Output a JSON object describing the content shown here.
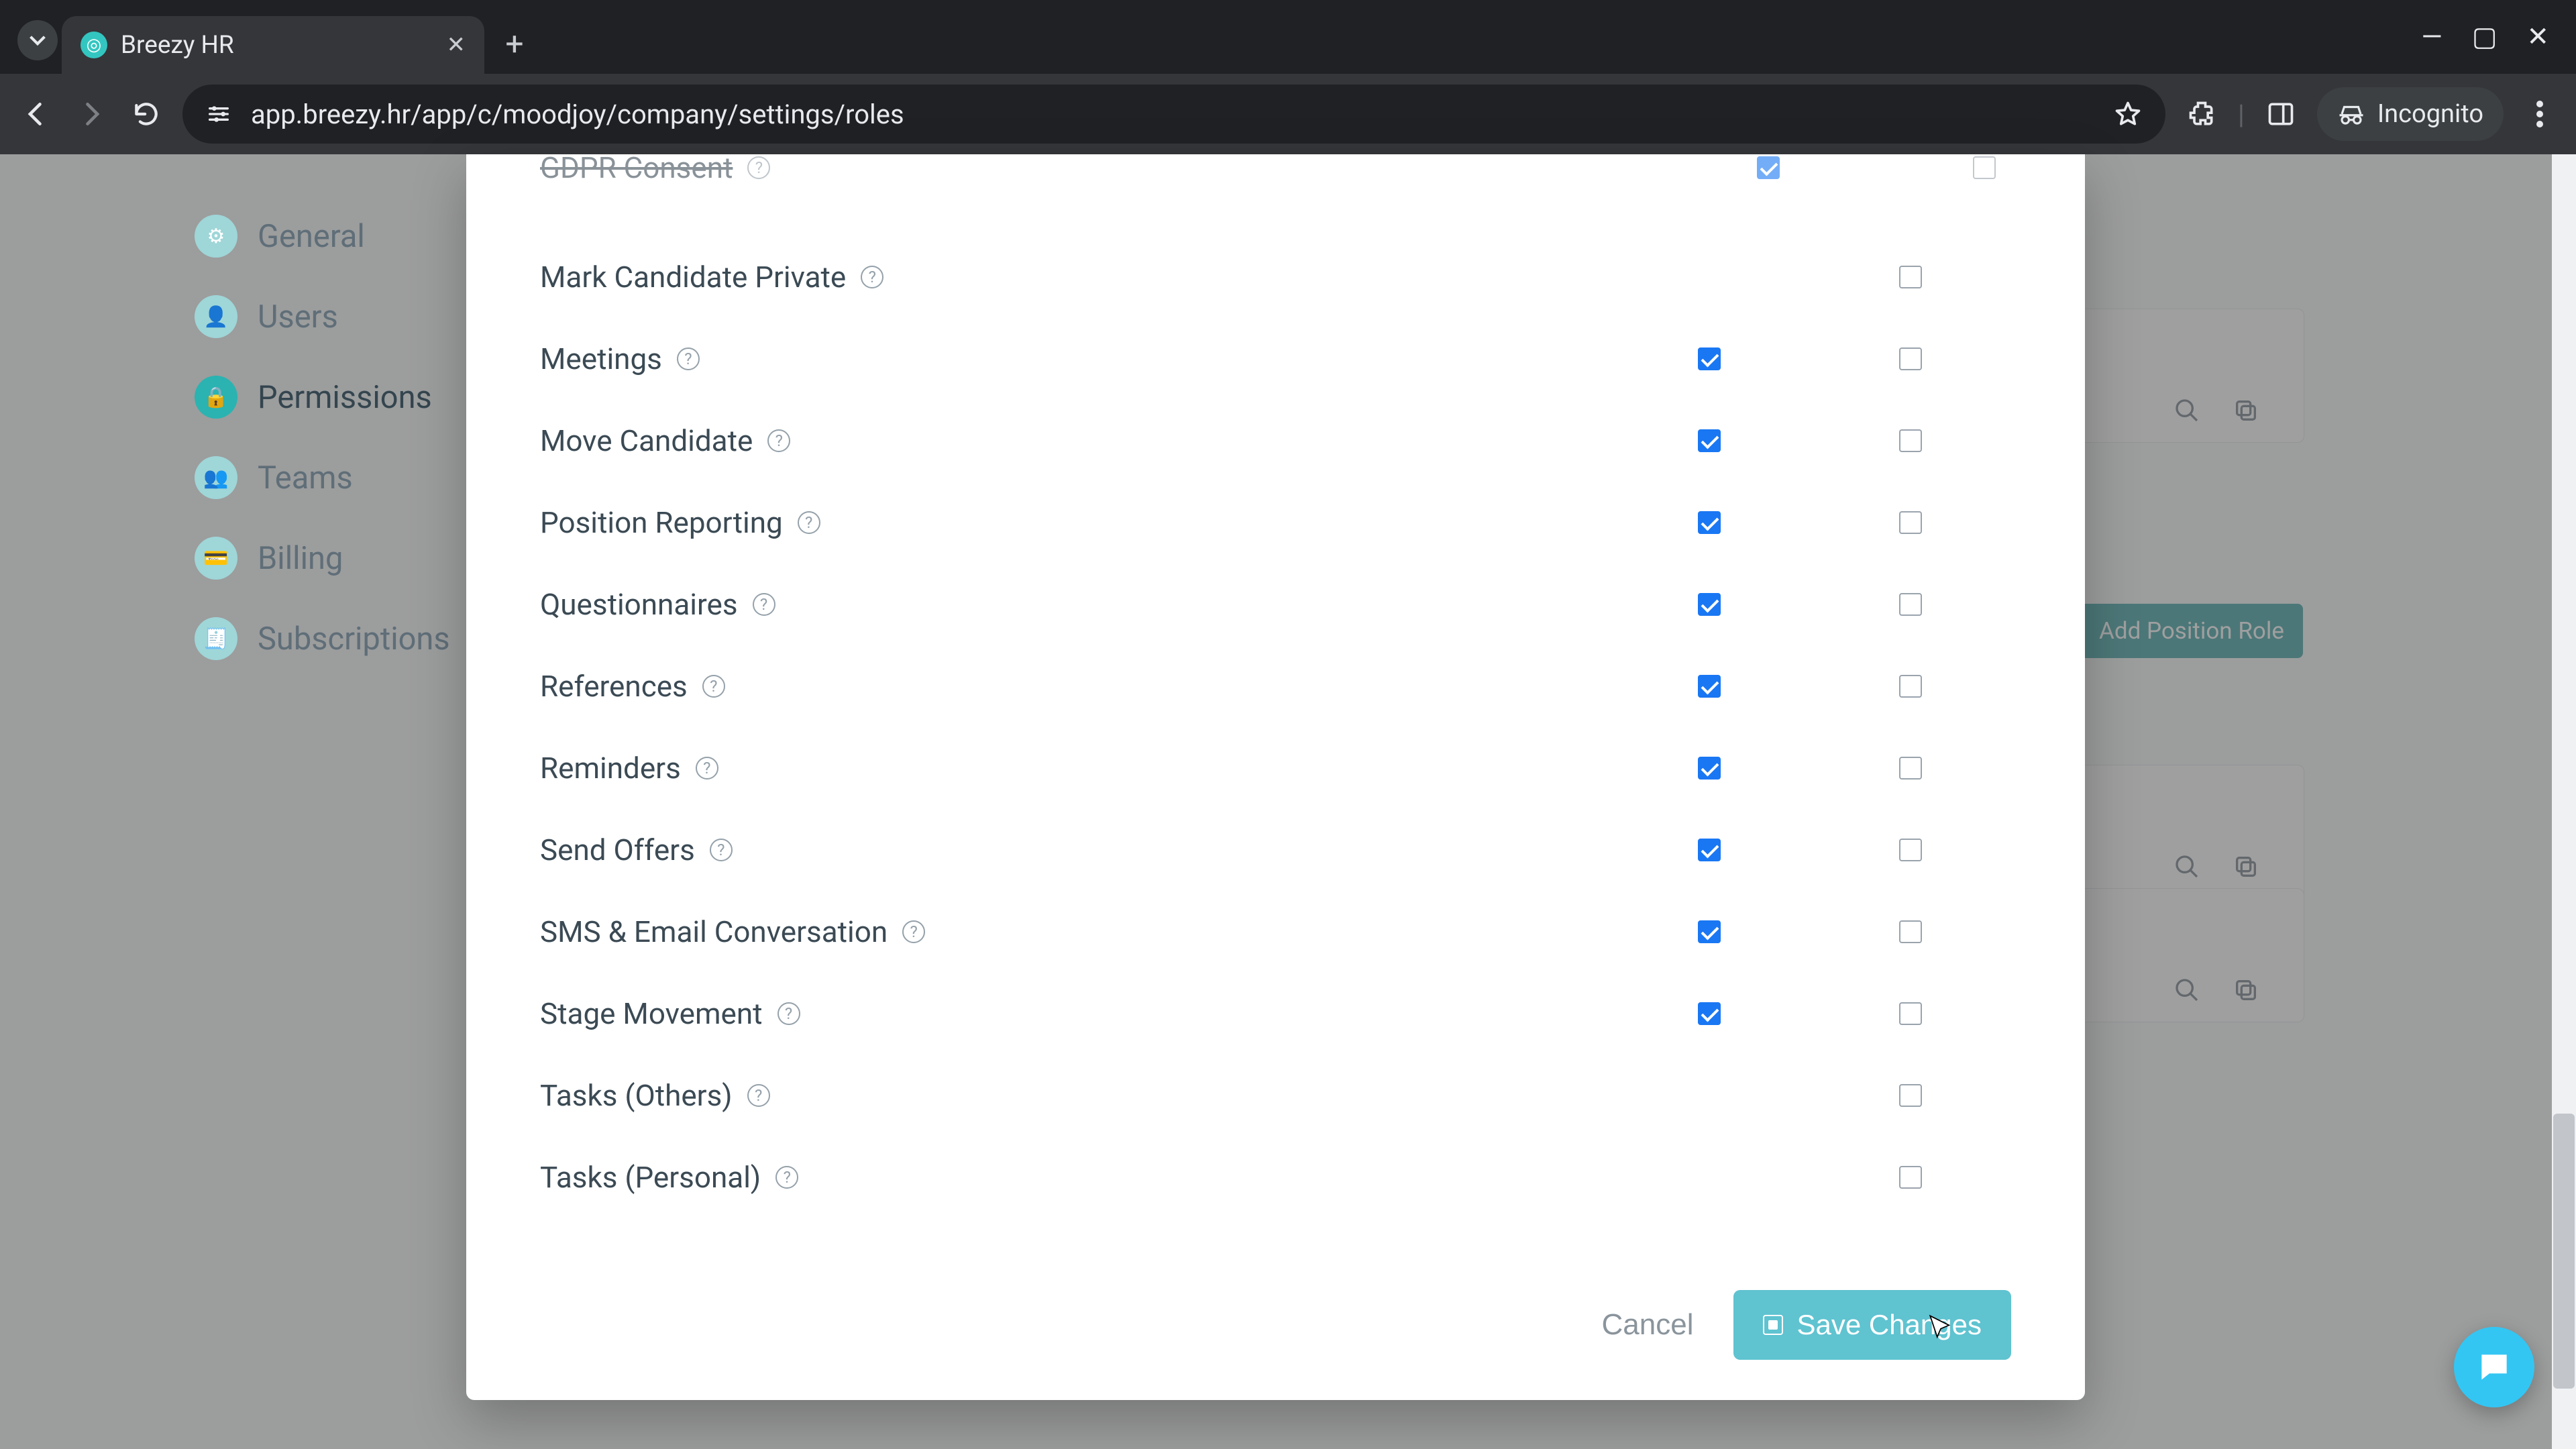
{
  "browser": {
    "tab_title": "Breezy HR",
    "url": "app.breezy.hr/app/c/moodjoy/company/settings/roles",
    "incognito_label": "Incognito"
  },
  "sidebar": {
    "items": [
      {
        "label": "General"
      },
      {
        "label": "Users"
      },
      {
        "label": "Permissions"
      },
      {
        "label": "Teams"
      },
      {
        "label": "Billing"
      },
      {
        "label": "Subscriptions"
      }
    ],
    "active_index": 2
  },
  "background": {
    "add_button": "Add Position Role"
  },
  "modal": {
    "cutoff_row": {
      "label": "GDPR Consent",
      "col1": true,
      "col2": false
    },
    "rows": [
      {
        "label": "Mark Candidate Private",
        "col1": null,
        "col2": false
      },
      {
        "label": "Meetings",
        "col1": true,
        "col2": false
      },
      {
        "label": "Move Candidate",
        "col1": true,
        "col2": false
      },
      {
        "label": "Position Reporting",
        "col1": true,
        "col2": false
      },
      {
        "label": "Questionnaires",
        "col1": true,
        "col2": false
      },
      {
        "label": "References",
        "col1": true,
        "col2": false
      },
      {
        "label": "Reminders",
        "col1": true,
        "col2": false
      },
      {
        "label": "Send Offers",
        "col1": true,
        "col2": false
      },
      {
        "label": "SMS & Email Conversation",
        "col1": true,
        "col2": false
      },
      {
        "label": "Stage Movement",
        "col1": true,
        "col2": false
      },
      {
        "label": "Tasks (Others)",
        "col1": null,
        "col2": false
      },
      {
        "label": "Tasks (Personal)",
        "col1": null,
        "col2": false
      }
    ],
    "cancel": "Cancel",
    "save": "Save Changes"
  },
  "colors": {
    "accent": "#5fc3d0",
    "check": "#1977f3",
    "teal": "#2ab3b1"
  }
}
